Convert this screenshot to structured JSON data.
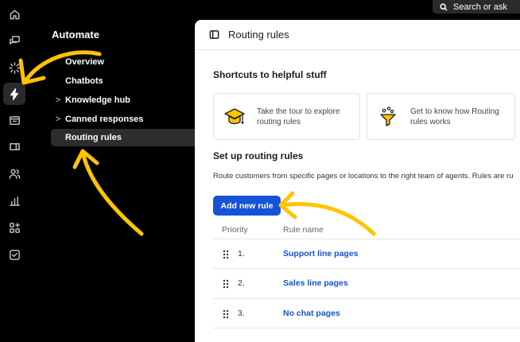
{
  "search": {
    "label": "Search or ask"
  },
  "rail": {
    "icons": [
      "home-icon",
      "chat-icon",
      "sparkle-icon",
      "bolt-icon",
      "inbox-icon",
      "ticket-icon",
      "people-icon",
      "reports-icon",
      "apps-icon",
      "checklist-icon"
    ],
    "active": "bolt-icon"
  },
  "sidebar": {
    "title": "Automate",
    "items": [
      {
        "label": "Overview",
        "chevron": ""
      },
      {
        "label": "Chatbots",
        "chevron": ""
      },
      {
        "label": "Knowledge hub",
        "chevron": ">"
      },
      {
        "label": "Canned responses",
        "chevron": ">"
      },
      {
        "label": "Routing rules",
        "chevron": "",
        "active": true
      }
    ]
  },
  "header": {
    "title": "Routing rules"
  },
  "shortcuts": {
    "title": "Shortcuts to helpful stuff",
    "cards": [
      {
        "line1": "Take the tour to explore",
        "line2": "routing rules",
        "icon": "graduation-cap-icon"
      },
      {
        "line1": "Get to know how Routing",
        "line2": "rules works",
        "icon": "funnel-icon"
      }
    ]
  },
  "setup": {
    "title": "Set up routing rules",
    "description": "Route customers from specific pages or locations to the right team of agents. Rules are ru",
    "add_button": "Add new rule"
  },
  "table": {
    "columns": [
      "Priority",
      "Rule name"
    ],
    "rows": [
      {
        "priority": "1.",
        "name": "Support line pages"
      },
      {
        "priority": "2.",
        "name": "Sales line pages"
      },
      {
        "priority": "3.",
        "name": "No chat pages"
      }
    ]
  },
  "colors": {
    "accent": "#1552d6",
    "annotation": "#ffc400",
    "background": "#000000"
  }
}
